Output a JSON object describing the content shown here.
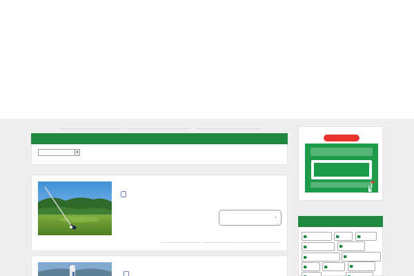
{
  "header": {
    "site_title": "",
    "tagline": "",
    "nav": [
      {
        "label": ""
      },
      {
        "label": ""
      },
      {
        "label": ""
      },
      {
        "label": ""
      }
    ]
  },
  "main": {
    "category_heading": "",
    "sort_select": {
      "value": ""
    },
    "posts": [
      {
        "title": "",
        "dates": [
          ""
        ],
        "categories": [
          ""
        ],
        "excerpt": "",
        "read_more": ""
      },
      {
        "title": "",
        "dates": [
          "",
          ""
        ],
        "categories": [
          ""
        ]
      }
    ]
  },
  "sidebar": {
    "tags_heading": "",
    "tags": [
      "",
      "",
      "",
      "",
      "",
      "",
      "",
      "",
      "",
      "",
      "",
      ""
    ]
  },
  "colors": {
    "accent_green": "#1f8a3f",
    "category_badge": "#2a3f95",
    "ad_background": "#1e9b49",
    "ad_pill": "#e8342c"
  },
  "icons": {
    "read_more": "chevron-right-icon",
    "tag": "tag-icon",
    "select": "caret-down-icon"
  }
}
